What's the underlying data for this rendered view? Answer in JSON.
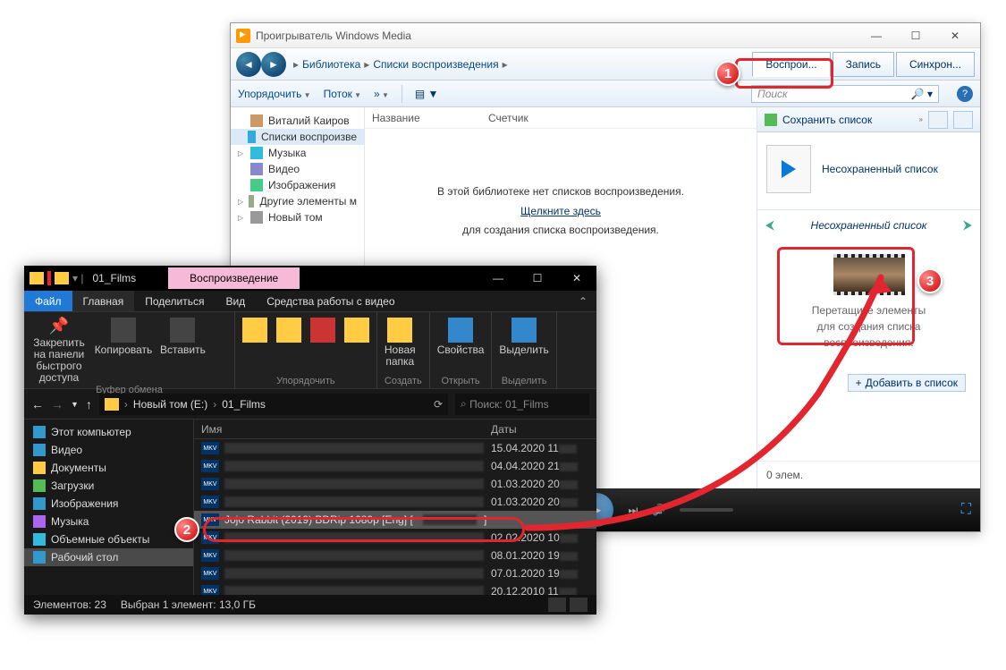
{
  "wmp": {
    "title": "Проигрыватель Windows Media",
    "breadcrumb": [
      "Библиотека",
      "Списки воспроизведения"
    ],
    "tabs": {
      "play": "Воспрои...",
      "burn": "Запись",
      "sync": "Синхрон..."
    },
    "toolbar": {
      "organize": "Упорядочить",
      "stream": "Поток",
      "more": "»"
    },
    "search_placeholder": "Поиск",
    "left_items": [
      {
        "label": "Виталий Каиров",
        "icon": "user"
      },
      {
        "label": "Списки воспроизве",
        "icon": "playlist",
        "selected": true
      },
      {
        "label": "Музыка",
        "icon": "music",
        "expandable": true
      },
      {
        "label": "Видео",
        "icon": "video"
      },
      {
        "label": "Изображения",
        "icon": "image"
      },
      {
        "label": "Другие элементы м",
        "icon": "other",
        "expandable": true
      },
      {
        "label": "Новый том",
        "icon": "disk",
        "expandable": true
      }
    ],
    "cols": {
      "name": "Название",
      "counter": "Счетчик"
    },
    "empty": {
      "line1": "В этой библиотеке нет списков воспроизведения.",
      "link": "Щелкните здесь",
      "line2": "для создания списка воспроизведения."
    },
    "right": {
      "save": "Сохранить список",
      "title": "Несохраненный список",
      "nav_label": "Несохраненный список",
      "drop1": "Перетащите элементы",
      "drop2": "для создания списка",
      "drop3": "воспроизведения.",
      "add": "Добавить в список",
      "count": "0 элем."
    }
  },
  "explorer": {
    "title": "01_Films",
    "pink_tab": "Воспроизведение",
    "tabs": {
      "file": "Файл",
      "home": "Главная",
      "share": "Поделиться",
      "view": "Вид",
      "video": "Средства работы с видео"
    },
    "ribbon": {
      "pin": "Закрепить на панели\nбыстрого доступа",
      "copy": "Копировать",
      "paste": "Вставить",
      "g1": "Буфер обмена",
      "newfolder": "Новая\nпапка",
      "g2": "Упорядочить",
      "g3": "Создать",
      "props": "Свойства",
      "g4": "Открыть",
      "select": "Выделить",
      "g5": "Выделить"
    },
    "path": {
      "drive": "Новый том (E:)",
      "folder": "01_Films"
    },
    "search_placeholder": "Поиск: 01_Films",
    "tree": [
      {
        "label": "Этот компьютер",
        "icon": "pc"
      },
      {
        "label": "Видео",
        "icon": "video"
      },
      {
        "label": "Документы",
        "icon": "doc"
      },
      {
        "label": "Загрузки",
        "icon": "dl"
      },
      {
        "label": "Изображения",
        "icon": "img"
      },
      {
        "label": "Музыка",
        "icon": "mus"
      },
      {
        "label": "Объемные объекты",
        "icon": "3d"
      },
      {
        "label": "Рабочий стол",
        "icon": "desk",
        "selected": true
      }
    ],
    "cols": {
      "name": "Имя",
      "date": "Даты"
    },
    "rows": [
      {
        "date": "15.04.2020 11"
      },
      {
        "date": "04.04.2020 21"
      },
      {
        "date": "01.03.2020 20"
      },
      {
        "date": "01.03.2020 20"
      },
      {
        "name": "Jojo Rabbit (2019) BDRip 1080p [Eng] [",
        "selected": true,
        "date": ""
      },
      {
        "date": "02.02.2020 10"
      },
      {
        "date": "08.01.2020 19"
      },
      {
        "date": "07.01.2020 19"
      },
      {
        "date": "20.12.2010 11"
      }
    ],
    "status": {
      "count": "Элементов: 23",
      "selected": "Выбран 1 элемент: 13,0 ГБ"
    }
  },
  "badges": {
    "b1": "1",
    "b2": "2",
    "b3": "3"
  }
}
